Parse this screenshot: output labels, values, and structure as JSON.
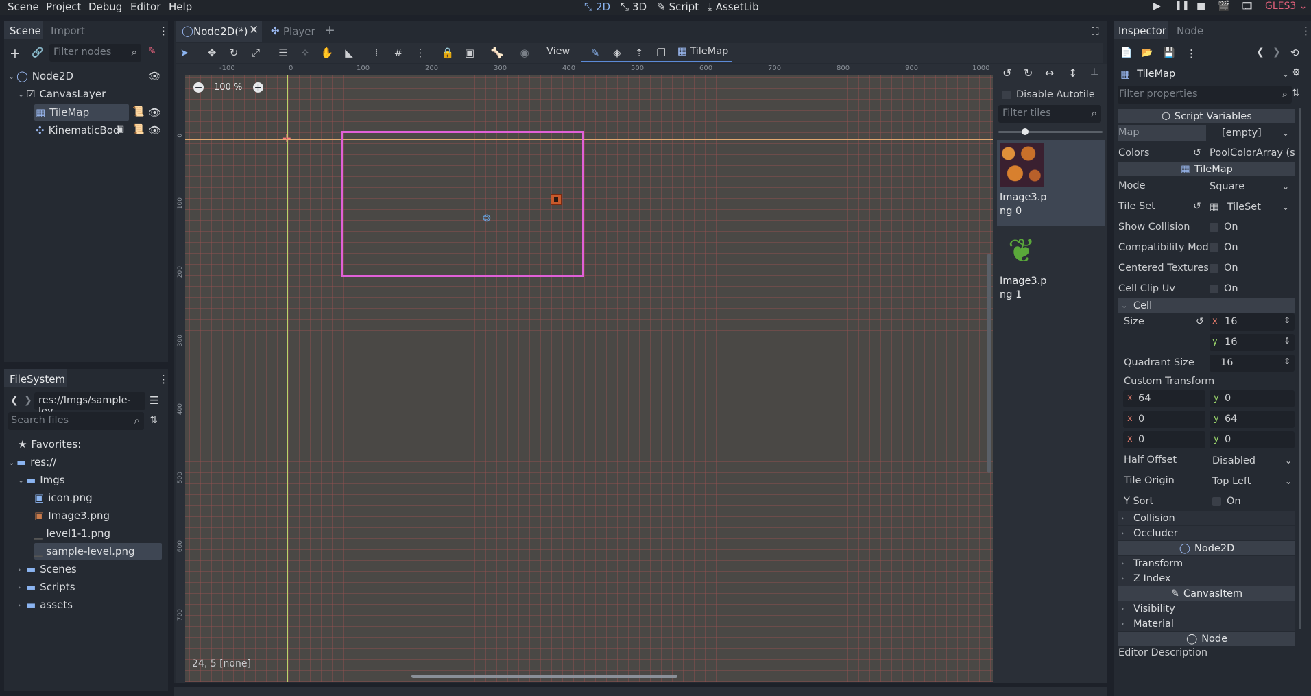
{
  "menu": [
    "Scene",
    "Project",
    "Debug",
    "Editor",
    "Help"
  ],
  "main_tabs": [
    {
      "label": "2D",
      "active": true
    },
    {
      "label": "3D",
      "active": false
    },
    {
      "label": "Script",
      "active": false
    },
    {
      "label": "AssetLib",
      "active": false
    }
  ],
  "renderer": "GLES3",
  "scene_dock": {
    "tabs": [
      "Scene",
      "Import"
    ],
    "filter_placeholder": "Filter nodes",
    "tree": [
      {
        "label": "Node2D",
        "icon": "node2d-icon"
      },
      {
        "label": "CanvasLayer",
        "icon": "canvaslayer-icon"
      },
      {
        "label": "TileMap",
        "icon": "tilemap-icon",
        "selected": true
      },
      {
        "label": "KinematicBod",
        "icon": "kinematicbody-icon"
      }
    ]
  },
  "filesystem": {
    "tab": "FileSystem",
    "path": "res://Imgs/sample-lev",
    "search_placeholder": "Search files",
    "favorites": "Favorites:",
    "root": "res://",
    "items": [
      {
        "label": "Imgs",
        "type": "folder"
      },
      {
        "label": "icon.png",
        "type": "file"
      },
      {
        "label": "Image3.png",
        "type": "file"
      },
      {
        "label": "level1-1.png",
        "type": "file"
      },
      {
        "label": "sample-level.png",
        "type": "file",
        "selected": true
      },
      {
        "label": "Scenes",
        "type": "folder"
      },
      {
        "label": "Scripts",
        "type": "folder"
      },
      {
        "label": "assets",
        "type": "folder"
      }
    ]
  },
  "editor_tabs": [
    {
      "label": "Node2D(*)",
      "active": true
    },
    {
      "label": "Player",
      "active": false
    }
  ],
  "toolbar": {
    "view_label": "View",
    "tilemap_label": "TileMap"
  },
  "viewport": {
    "zoom": "100 %",
    "status": "24, 5 [none]",
    "ruler_top": [
      "-100",
      "0",
      "100",
      "200",
      "300",
      "400",
      "500",
      "600",
      "700",
      "800",
      "900",
      "1000"
    ],
    "ruler_left": [
      "0",
      "100",
      "200",
      "300",
      "400",
      "500",
      "600",
      "700"
    ]
  },
  "tile_palette": {
    "disable_autotile": "Disable Autotile",
    "filter_placeholder": "Filter tiles",
    "tiles": [
      {
        "label": "Image3.png 0",
        "selected": true
      },
      {
        "label": "Image3.png 1",
        "selected": false
      }
    ]
  },
  "inspector": {
    "tabs": [
      "Inspector",
      "Node"
    ],
    "object": "TileMap",
    "filter_placeholder": "Filter properties",
    "script_variables": "Script Variables",
    "map_label": "Map",
    "map_value": "[empty]",
    "colors_label": "Colors",
    "colors_value": "PoolColorArray (s",
    "tilemap_section": "TileMap",
    "mode_label": "Mode",
    "mode_value": "Square",
    "tileset_label": "Tile Set",
    "tileset_value": "TileSet",
    "show_collision": "Show Collision",
    "compat_mode": "Compatibility Mod",
    "centered_textures": "Centered Textures",
    "cell_clip_uv": "Cell Clip Uv",
    "on_label": "On",
    "cell_section": "Cell",
    "size_label": "Size",
    "size_x": "16",
    "size_y": "16",
    "quadrant_label": "Quadrant Size",
    "quadrant_value": "16",
    "custom_transform": "Custom Transform",
    "transform": [
      [
        "64",
        "0"
      ],
      [
        "0",
        "64"
      ],
      [
        "0",
        "0"
      ]
    ],
    "half_offset_label": "Half Offset",
    "half_offset_value": "Disabled",
    "tile_origin_label": "Tile Origin",
    "tile_origin_value": "Top Left",
    "ysort_label": "Y Sort",
    "collision": "Collision",
    "occluder": "Occluder",
    "node2d_section": "Node2D",
    "transform_row": "Transform",
    "zindex_row": "Z Index",
    "canvasitem_section": "CanvasItem",
    "visibility_row": "Visibility",
    "material_row": "Material",
    "node_section": "Node",
    "editor_description": "Editor Description"
  }
}
